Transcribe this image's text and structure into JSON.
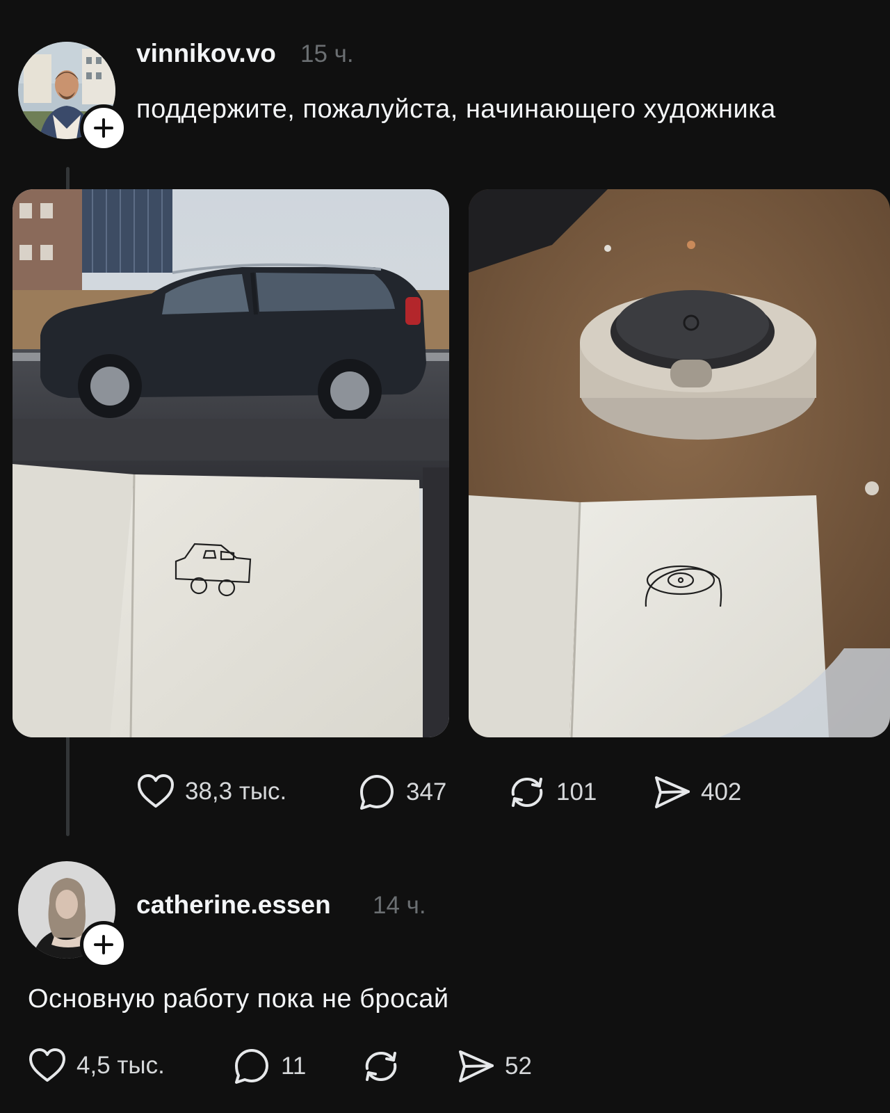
{
  "posts": [
    {
      "username": "vinnikov.vo",
      "time": "15 ч.",
      "text": "поддержите, пожалуйста, начинающего художника",
      "likes": "38,3 тыс.",
      "comments": "347",
      "reposts": "101",
      "shares": "402"
    },
    {
      "username": "catherine.essen",
      "time": "14 ч.",
      "text": "Основную работу пока не бросай",
      "likes": "4,5 тыс.",
      "comments": "11",
      "shares": "52"
    }
  ],
  "icons": {
    "follow": "plus-icon",
    "like": "heart-icon",
    "comment": "comment-bubble-icon",
    "repost": "repost-arrows-icon",
    "share": "send-paper-plane-icon"
  },
  "colors": {
    "background": "#101010",
    "text": "#f3f5f7",
    "muted": "#6b6f72",
    "thread_line": "#333638"
  }
}
